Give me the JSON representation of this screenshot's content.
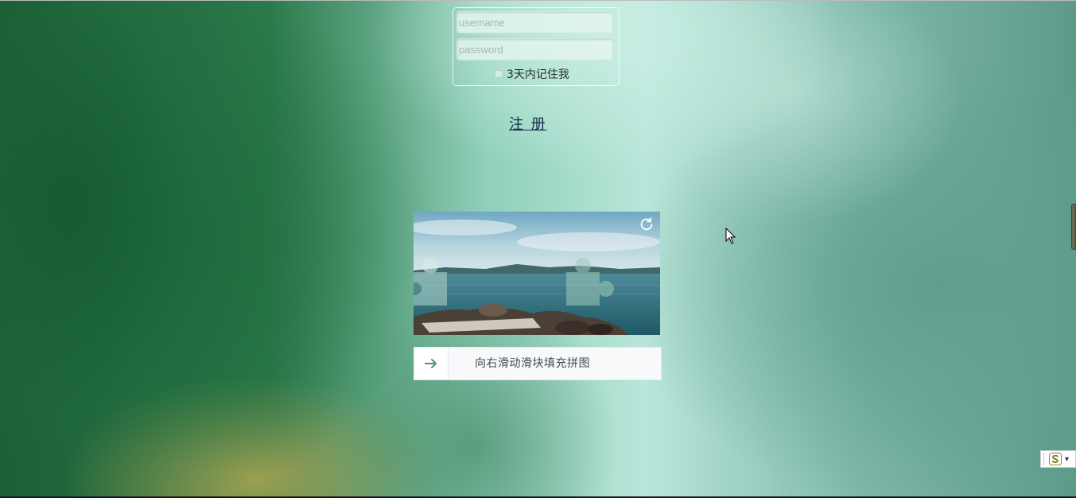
{
  "login": {
    "username_placeholder": "username",
    "password_placeholder": "password",
    "remember_label": "3天内记住我"
  },
  "register": {
    "label": "注 册"
  },
  "captcha": {
    "slider_hint": "向右滑动滑块填充拼图",
    "handle_icon": "arrow-right-icon",
    "refresh_icon": "refresh-icon"
  },
  "colors": {
    "accent": "#4f8f7f",
    "link": "#13284a"
  }
}
